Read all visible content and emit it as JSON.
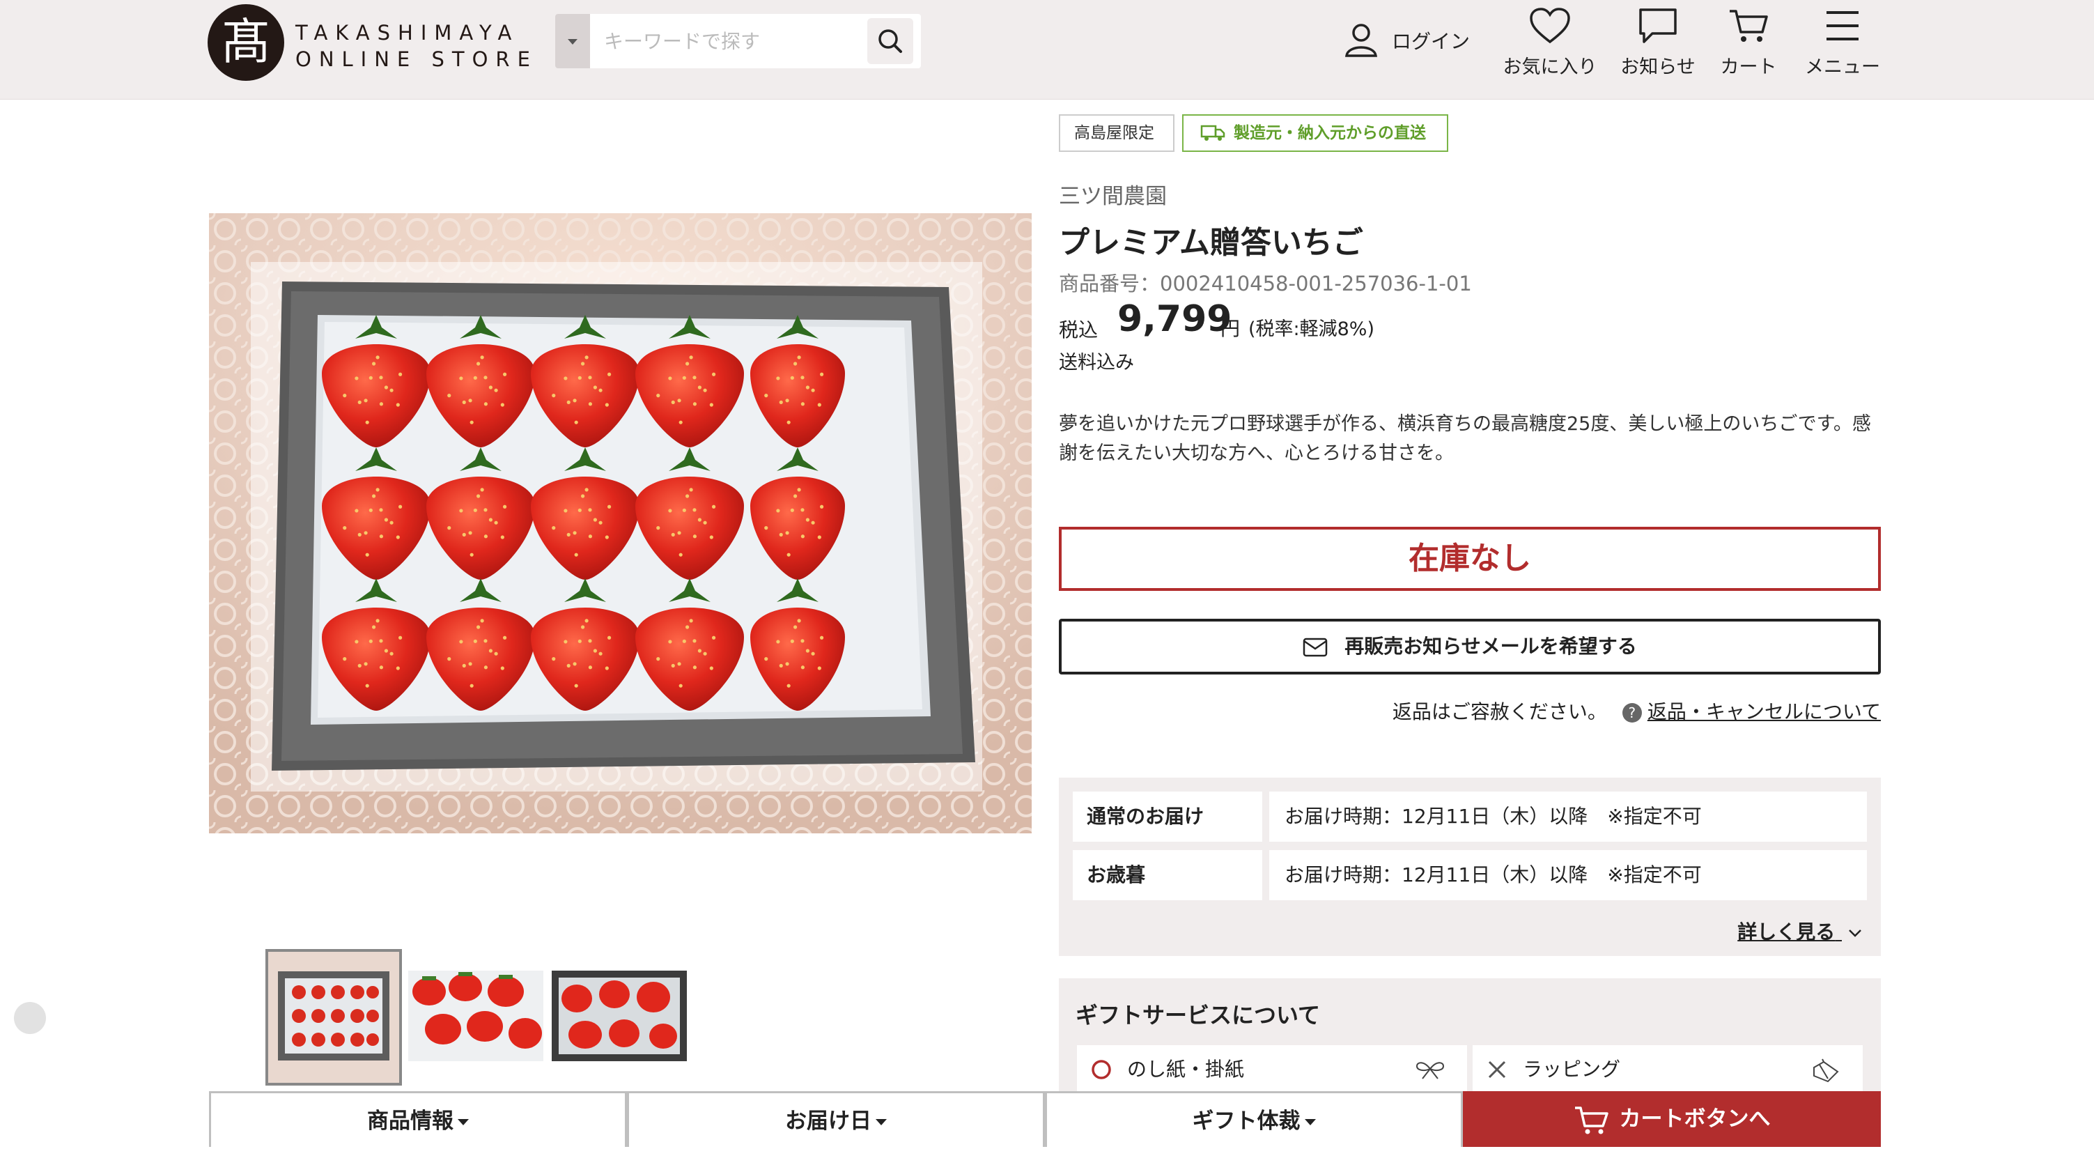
{
  "header": {
    "logo_kanji": "髙",
    "logo_line1": "TAKASHIMAYA",
    "logo_line2": "ONLINE STORE",
    "search_placeholder": "キーワードで探す",
    "login_label": "ログイン",
    "nav": [
      {
        "label": "お気に入り",
        "icon": "heart-icon"
      },
      {
        "label": "お知らせ",
        "icon": "chat-bubble-icon"
      },
      {
        "label": "カート",
        "icon": "cart-icon"
      },
      {
        "label": "メニュー",
        "icon": "hamburger-menu-icon"
      }
    ]
  },
  "product": {
    "badges": [
      "高島屋限定",
      "製造元・納入元からの直送"
    ],
    "brand": "三ツ間農園",
    "title": "プレミアム贈答いちご",
    "sku": "商品番号：0002410458-001-257036-1-01",
    "price_prefix": "税込",
    "price": "9,799",
    "price_unit": "円",
    "tax_note": "(税率:軽減8%)",
    "shipping": "送料込み",
    "description": "夢を追いかけた元プロ野球選手が作る、横浜育ちの最高糖度25度、美しい極上のいちごです。感謝を伝えたい大切な方へ、心とろける甘さを。",
    "stock_status": "在庫なし",
    "notify_button": "再販売お知らせメールを希望する",
    "returns_text": "返品はご容赦ください。",
    "returns_help_icon": "?",
    "returns_link": "返品・キャンセルについて"
  },
  "delivery": {
    "rows": [
      {
        "label": "通常のお届け",
        "value": "お届け時期：12月11日（木）以降　※指定不可"
      },
      {
        "label": "お歳暮",
        "value": "お届け時期：12月11日（木）以降　※指定不可"
      }
    ],
    "more_link": "詳しく見る"
  },
  "gift": {
    "title": "ギフトサービスについて",
    "items": [
      {
        "label": "のし紙・掛紙",
        "available": true,
        "icon": "noshi-ribbon-icon"
      },
      {
        "label": "ラッピング",
        "available": false,
        "icon": "wrapping-bag-icon"
      }
    ]
  },
  "bottom_bar": {
    "tabs": [
      "商品情報",
      "お届け日",
      "ギフト体裁"
    ],
    "cart_button": "カートボタンへ"
  },
  "colors": {
    "header_bg": "#f1eded",
    "accent_red": "#b22d2d",
    "badge_green": "#7ab547"
  }
}
